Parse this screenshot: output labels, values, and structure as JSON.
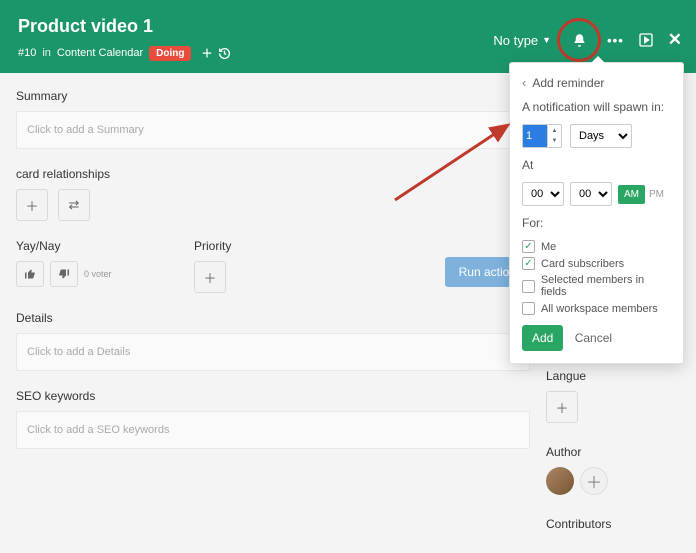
{
  "header": {
    "title": "Product video 1",
    "card_number": "#10",
    "in": "in",
    "location": "Content Calendar",
    "status": "Doing",
    "no_type": "No type"
  },
  "sections": {
    "summary_label": "Summary",
    "summary_placeholder": "Click to add a Summary",
    "relationships_label": "card relationships",
    "yaynay_label": "Yay/Nay",
    "priority_label": "Priority",
    "voter_text": "0 voter",
    "run_action": "Run action",
    "details_label": "Details",
    "details_placeholder": "Click to add a Details",
    "seo_label": "SEO keywords",
    "seo_placeholder": "Click to add a SEO keywords"
  },
  "sidebar": {
    "langue": "Langue",
    "author": "Author",
    "contributors": "Contributors"
  },
  "popover": {
    "title": "Add reminder",
    "spawn_text": "A notification will spawn in:",
    "number_value": "1",
    "unit": "Days",
    "at_label": "At",
    "hour": "00",
    "minute": "00",
    "am": "AM",
    "pm": "PM",
    "for_label": "For:",
    "opts": {
      "me": "Me",
      "subs": "Card subscribers",
      "sel": "Selected members in fields",
      "all": "All workspace members"
    },
    "add": "Add",
    "cancel": "Cancel"
  }
}
